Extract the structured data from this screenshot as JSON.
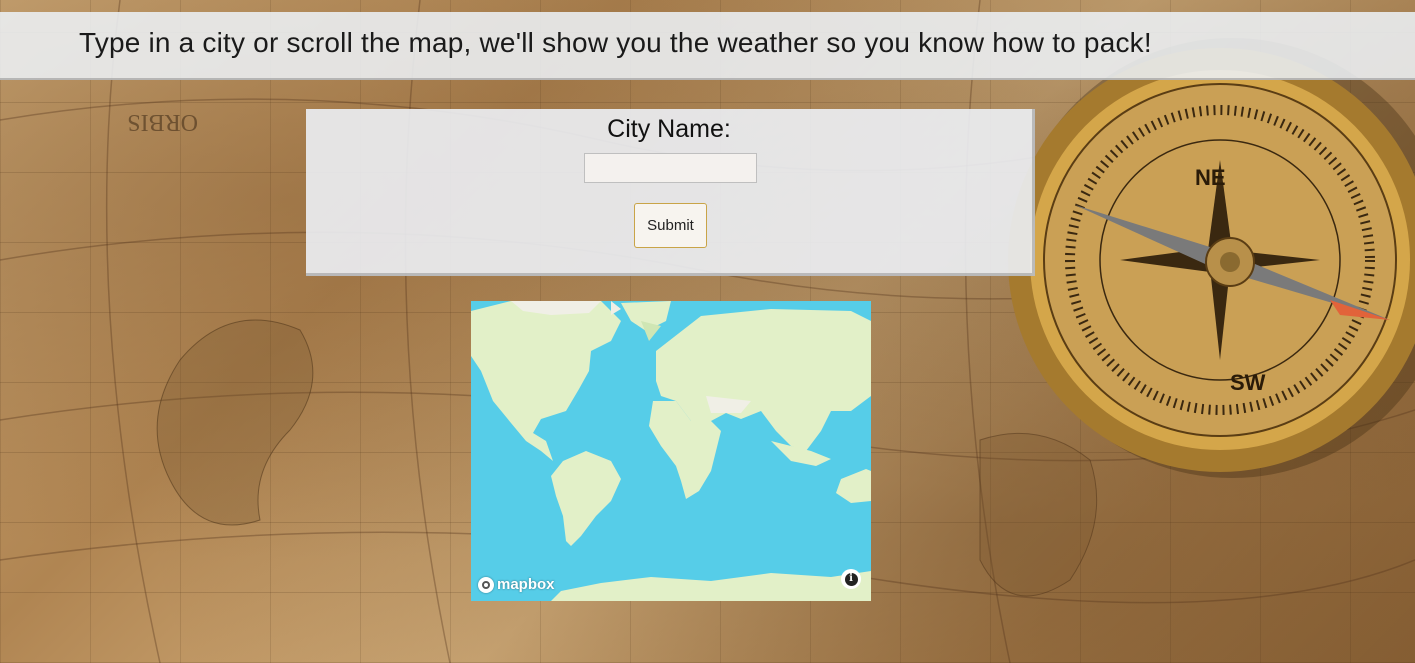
{
  "header": {
    "title": "Type in a city or scroll the map, we'll show you the weather so you know how to pack!"
  },
  "form": {
    "label": "City Name:",
    "input_value": "",
    "input_placeholder": "",
    "submit_label": "Submit"
  },
  "map": {
    "attribution_logo": "mapbox",
    "info_icon": "info-icon",
    "water_color": "#56cde8",
    "land_color": "#e2f0c8"
  },
  "background": {
    "description_icons": [
      "compass-icon",
      "old-world-map-icon"
    ]
  }
}
